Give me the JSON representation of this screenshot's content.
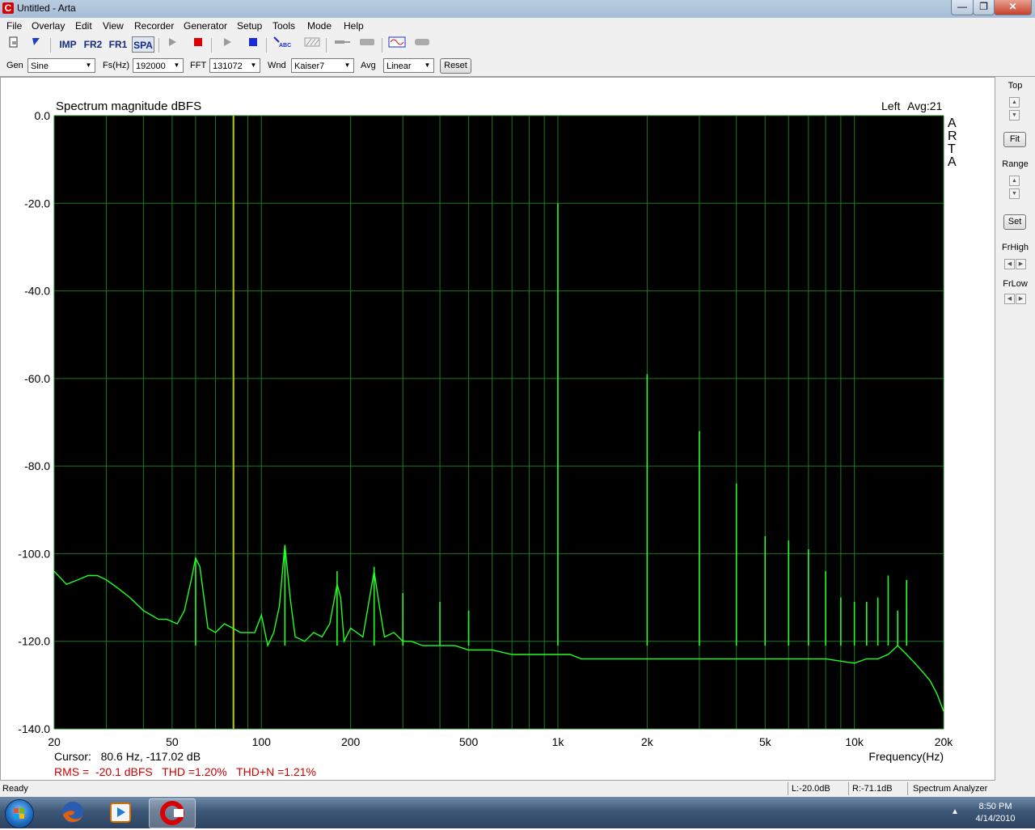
{
  "window": {
    "title": "Untitled - Arta",
    "icon": "arta-logo-icon",
    "buttons": {
      "minimize": "0",
      "maximize": "1",
      "close": "r"
    }
  },
  "menu": [
    "File",
    "Overlay",
    "Edit",
    "View",
    "Recorder",
    "Generator",
    "Setup",
    "Tools",
    "Mode",
    "Help"
  ],
  "toolbar": {
    "imp": "IMP",
    "fr2": "FR2",
    "fr1": "FR1",
    "spa": "SPA",
    "icons": [
      "new-icon",
      "open-icon",
      "play-icon",
      "stop-icon",
      "record-play-icon",
      "record-stop-icon",
      "abc-icon",
      "pattern-icon",
      "probe-icon",
      "switch-icon",
      "generator-wave-icon",
      "toggle-icon"
    ]
  },
  "controls": {
    "gen_label": "Gen",
    "gen_value": "Sine",
    "fs_label": "Fs(Hz)",
    "fs_value": "192000",
    "fft_label": "FFT",
    "fft_value": "131072",
    "wnd_label": "Wnd",
    "wnd_value": "Kaiser7",
    "avg_label": "Avg",
    "avg_value": "Linear",
    "reset_label": "Reset"
  },
  "side_panel": {
    "top": "Top",
    "fit": "Fit",
    "range": "Range",
    "set": "Set",
    "frhigh": "FrHigh",
    "frlow": "FrLow"
  },
  "status": {
    "left": "Ready",
    "l_level": "L:-20.0dB",
    "r_level": "R:-71.1dB",
    "mode": "Spectrum Analyzer"
  },
  "taskbar": {
    "time": "8:50 PM",
    "date": "4/14/2010",
    "apps": [
      "firefox-icon",
      "media-player-icon",
      "arta-icon"
    ]
  },
  "colors": {
    "plot_bg": "#000000",
    "grid": "#1d7a1d",
    "trace": "#22ff22",
    "cursor": "#d8d820",
    "readout_red": "#cc0000"
  },
  "chart_data": {
    "type": "line",
    "title": "Spectrum magnitude dBFS",
    "channel": "Left",
    "avg_text": "Avg:21",
    "brand": "ARTA",
    "xlabel": "Frequency(Hz)",
    "ylabel": "",
    "x_scale": "log",
    "xlim": [
      20,
      20000
    ],
    "ylim": [
      -140,
      0
    ],
    "grid": true,
    "x_ticks": [
      "20",
      "50",
      "100",
      "200",
      "500",
      "1k",
      "2k",
      "5k",
      "10k",
      "20k"
    ],
    "y_ticks": [
      "0.0",
      "-20.0",
      "-40.0",
      "-60.0",
      "-80.0",
      "-100.0",
      "-120.0",
      "-140.0"
    ],
    "cursor": {
      "frequency_hz": 80.6,
      "level_db": -117.02,
      "text": "Cursor:   80.6 Hz, -117.02 dB"
    },
    "readout": "RMS =  -20.1 dBFS   THD =1.20%   THD+N =1.21%",
    "series": [
      {
        "x": [
          20,
          22,
          24,
          26,
          28,
          30,
          33,
          36,
          40,
          45,
          48,
          52,
          55,
          58,
          60,
          62,
          64,
          66,
          70,
          75,
          80,
          85,
          90,
          95,
          100,
          105,
          110,
          115,
          120,
          125,
          130,
          140,
          150,
          160,
          170,
          180,
          185,
          190,
          200,
          220,
          240,
          250,
          260,
          280,
          300,
          320,
          350,
          400,
          450,
          500,
          600,
          700,
          800,
          900,
          1000,
          1100,
          1200,
          1500,
          2000,
          3000,
          4000,
          5000,
          6000,
          7000,
          8000,
          10000,
          11000,
          12000,
          13000,
          13500,
          14000,
          15000,
          16000,
          17000,
          18000,
          19000,
          20000
        ],
        "y": [
          -104,
          -107,
          -106,
          -105,
          -105,
          -106,
          -108,
          -110,
          -113,
          -115,
          -115,
          -116,
          -113,
          -106,
          -101,
          -103,
          -110,
          -117,
          -118,
          -116,
          -117,
          -118,
          -118,
          -118,
          -114,
          -121,
          -118,
          -112,
          -98,
          -110,
          -119,
          -120,
          -118,
          -119,
          -116,
          -107,
          -110,
          -120,
          -117,
          -119,
          -104,
          -112,
          -119,
          -118,
          -120,
          -120,
          -121,
          -121,
          -121,
          -122,
          -122,
          -123,
          -123,
          -123,
          -123,
          -123,
          -124,
          -124,
          -124,
          -124,
          -124,
          -124,
          -124,
          -124,
          -124,
          -125,
          -124,
          -124,
          -123,
          -122,
          -121,
          -123,
          -125,
          -127,
          -129,
          -132,
          -136
        ]
      },
      {
        "x": [
          60,
          120,
          180,
          240,
          300,
          400,
          500,
          1000,
          2000,
          3000,
          4000,
          5000,
          6000,
          7000,
          8000,
          9000,
          10000,
          11000,
          12000,
          13000,
          14000,
          15000
        ],
        "y": [
          -101,
          -98,
          -104,
          -103,
          -109,
          -111,
          -113,
          -20,
          -59,
          -72,
          -84,
          -96,
          -97,
          -99,
          -104,
          -110,
          -111,
          -111,
          -110,
          -105,
          -113,
          -106
        ]
      }
    ]
  }
}
